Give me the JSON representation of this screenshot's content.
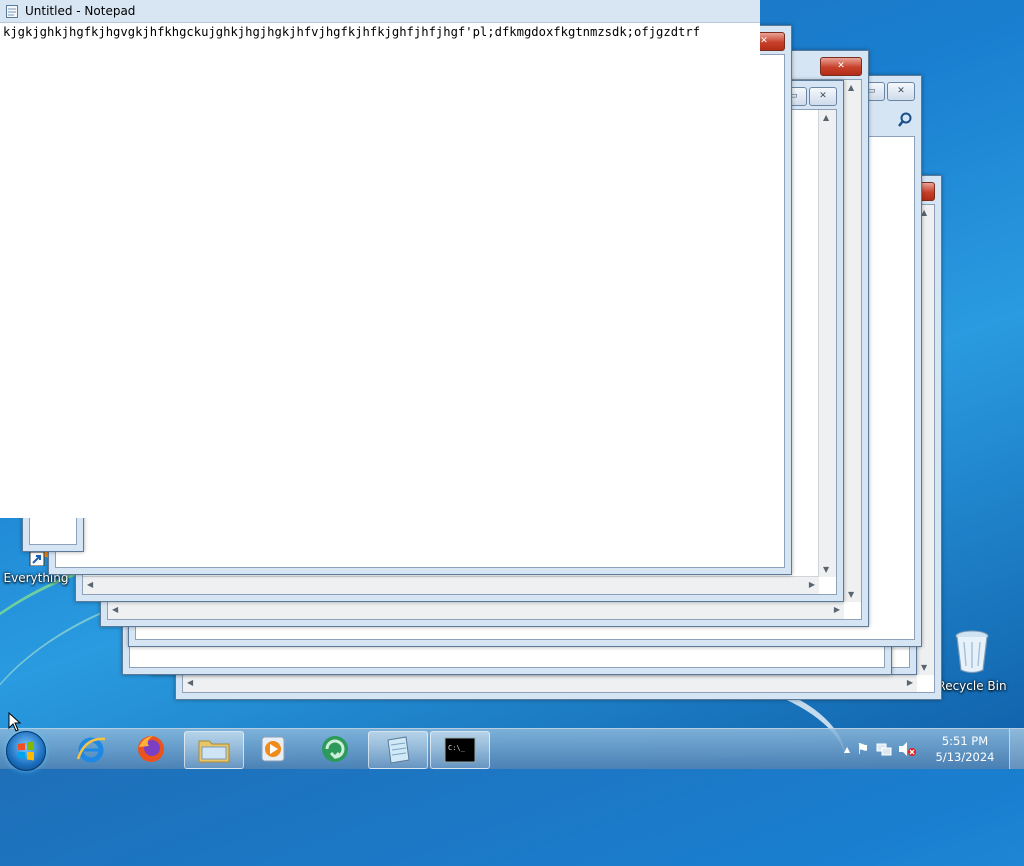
{
  "notepad": {
    "title": "Untitled - Notepad",
    "content": "kjgkjghkjhgfkjhgvgkjhfkhgckujghkjhgjhgkjhfvjhgfkjhfkjghfjhfjhgf'pl;dfkmgdoxfkgtnmzsdk;ofjgzdtrf"
  },
  "desktop": {
    "icons": [
      {
        "label": "Everything",
        "icon": "everything-shortcut-icon"
      },
      {
        "label": "Recycle Bin",
        "icon": "recycle-bin-icon"
      }
    ]
  },
  "window_controls": {
    "close_glyph": "✕",
    "restore_glyph": "▭",
    "scroll_up": "▲",
    "scroll_down": "▼",
    "scroll_left": "◀",
    "scroll_right": "▶"
  },
  "taskbar": {
    "start_icon": "windows-start-orb-icon",
    "pinned": [
      {
        "name": "internet-explorer",
        "icon": "internet-explorer-icon"
      },
      {
        "name": "firefox",
        "icon": "firefox-icon"
      },
      {
        "name": "file-explorer",
        "icon": "folder-icon"
      },
      {
        "name": "media-player",
        "icon": "media-player-icon"
      },
      {
        "name": "app-circle",
        "icon": "green-arrow-app-icon"
      },
      {
        "name": "notepad",
        "icon": "notepad-icon"
      },
      {
        "name": "command-prompt",
        "icon": "command-prompt-icon"
      }
    ],
    "cmd_glyph": "C:\\_",
    "tray": {
      "icons": [
        "show-hidden-icons-chevron",
        "action-center-flag-icon",
        "network-icon",
        "volume-muted-icon"
      ],
      "chevron_glyph": "▲",
      "flag_glyph": "⚑",
      "time": "5:51 PM",
      "date": "5/13/2024"
    }
  },
  "colors": {
    "desktop": "#1a7fd0",
    "close_button": "#c7402a",
    "window_frame": "#d6e5f4"
  }
}
